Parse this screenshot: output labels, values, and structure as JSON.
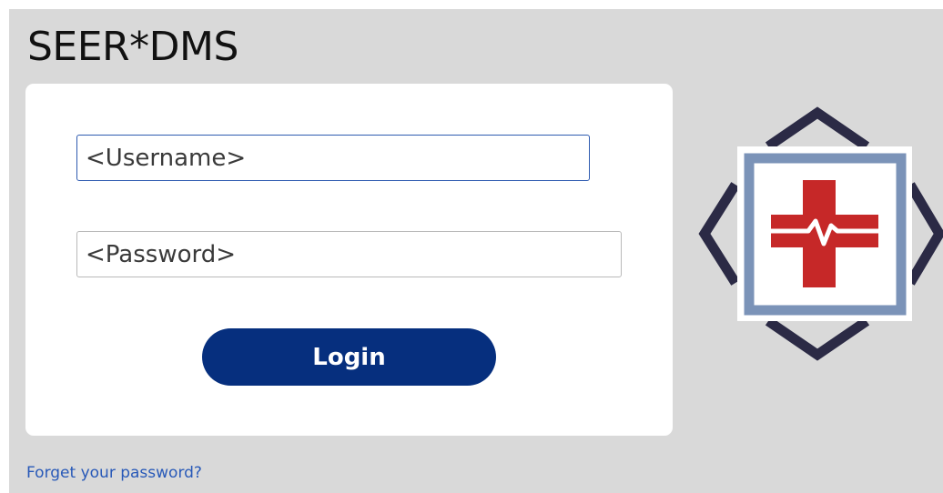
{
  "app": {
    "title": "SEER*DMS"
  },
  "login_form": {
    "username_placeholder": "<Username>",
    "username_value": "",
    "password_placeholder": "<Password>",
    "password_value": "",
    "login_label": "Login",
    "forgot_password_label": "Forget your password?"
  },
  "logo": {
    "icon": "medical-cross-heartbeat-logo",
    "colors": {
      "chevrons": "#2b2a45",
      "frame": "#7b93b8",
      "cross": "#c62828"
    }
  },
  "colors": {
    "background": "#d9d9d9",
    "card": "#ffffff",
    "button": "#062f7e",
    "link": "#2859b8",
    "focus_border": "#2f5bb0"
  }
}
